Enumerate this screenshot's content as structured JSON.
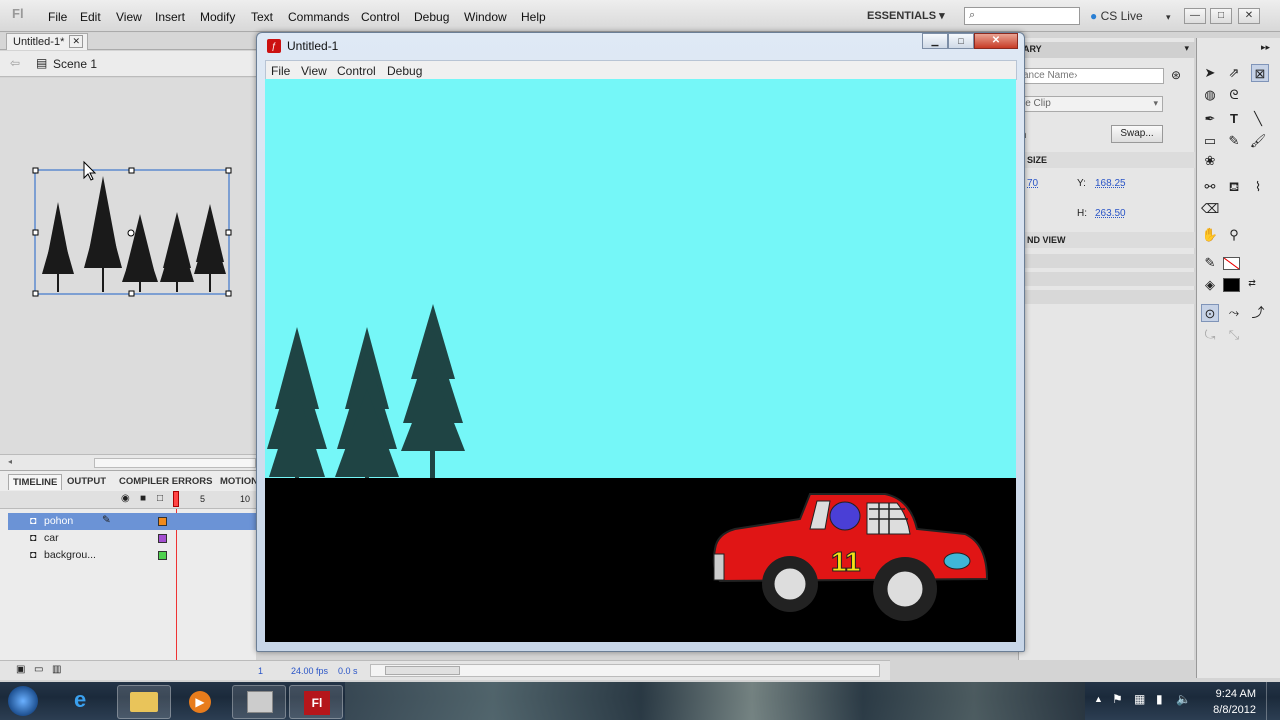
{
  "menubar": {
    "items": [
      "File",
      "Edit",
      "View",
      "Insert",
      "Modify",
      "Text",
      "Commands",
      "Control",
      "Debug",
      "Window",
      "Help"
    ],
    "workspace": "ESSENTIALS",
    "cs_live": "CS Live",
    "logo": "Fl"
  },
  "document": {
    "tab": "Untitled-1*",
    "scene": "Scene 1"
  },
  "timeline": {
    "tabs": [
      "TIMELINE",
      "OUTPUT",
      "COMPILER ERRORS",
      "MOTION"
    ],
    "frame_numbers": [
      "5",
      "10"
    ],
    "layers": [
      {
        "name": "pohon",
        "color": "#f08a1c"
      },
      {
        "name": "car",
        "color": "#a44fd1"
      },
      {
        "name": "backgrou...",
        "color": "#4fd14f"
      }
    ],
    "status": {
      "frame": "1",
      "fps": "24.00 fps",
      "time": "0.0 s"
    }
  },
  "player": {
    "title": "Untitled-1",
    "menu": [
      "File",
      "View",
      "Control",
      "Debug"
    ]
  },
  "properties": {
    "tab": "ARY",
    "instance_name": "ance Name›",
    "symbol_type": "ie Clip",
    "swap": "Swap...",
    "n_label": "n",
    "section_size": "SIZE",
    "x_value": "70",
    "y_label": "Y:",
    "y_value": "168.25",
    "h_label": "H:",
    "h_value": "263.50",
    "section_view": "ND VIEW"
  },
  "taskbar": {
    "time": "9:24 AM",
    "date": "8/8/2012",
    "fl_label": "Fl"
  },
  "colors": {
    "sky": "#75f7f8",
    "ground": "#000000",
    "car_body": "#e01515",
    "tree": "#1a3c3c"
  }
}
